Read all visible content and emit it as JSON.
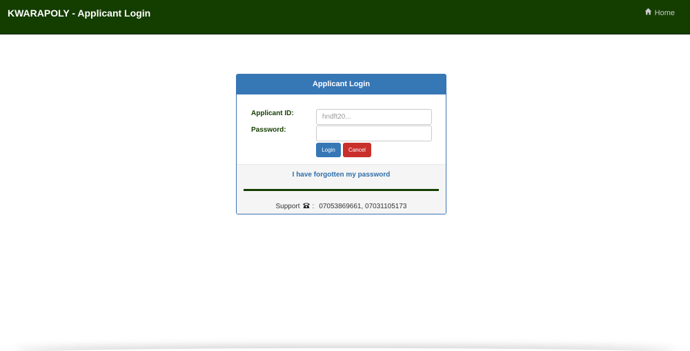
{
  "header": {
    "title": "KWARAPOLY - Applicant Login",
    "home_label": "Home",
    "home_icon": "home-icon"
  },
  "login_panel": {
    "heading": "Applicant Login",
    "applicant_id_label": "Applicant ID:",
    "applicant_id_placeholder": "hndft20...",
    "applicant_id_value": "",
    "password_label": "Password:",
    "password_value": "",
    "login_button": "Login",
    "cancel_button": "Cancel",
    "forgot_link": "I have forgotten my password",
    "support_label": "Support",
    "support_icon": "phone-icon",
    "support_separator": ":",
    "support_numbers": "07053869661, 07031105173"
  },
  "colors": {
    "navbar": "#143d00",
    "panel_heading": "#3677b6",
    "login_button": "#3677b6",
    "cancel_button": "#c9302c",
    "label_text": "#143d00",
    "link": "#2f6ea8"
  }
}
